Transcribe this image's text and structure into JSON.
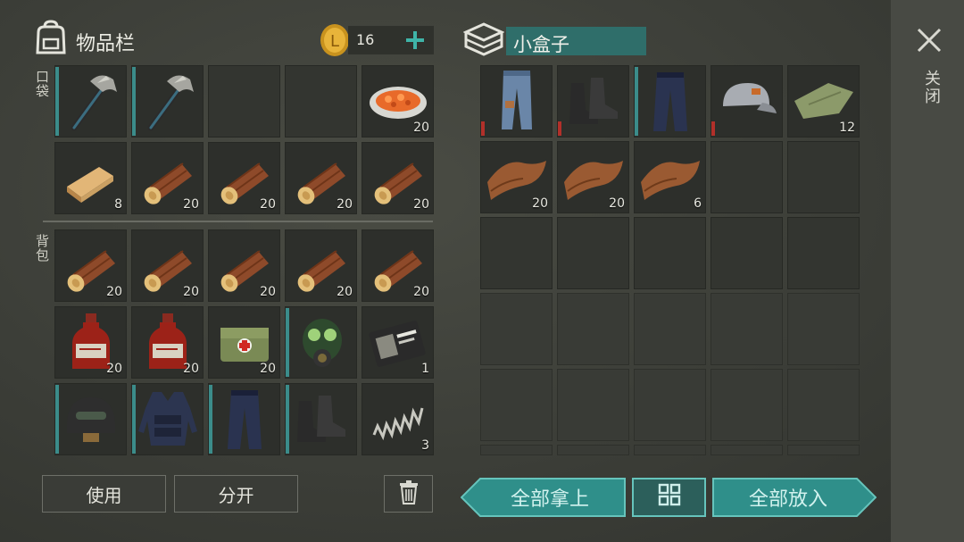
{
  "inventory": {
    "title": "物品栏",
    "coins": "16",
    "pocket_label": "口袋",
    "backpack_label": "背包"
  },
  "pocket": [
    {
      "name": "hatchet",
      "icon": "hatchet-icon",
      "qty": "",
      "dur": "teal"
    },
    {
      "name": "hatchet",
      "icon": "hatchet-icon",
      "qty": "",
      "dur": "teal"
    },
    {
      "name": "empty",
      "icon": "",
      "qty": "",
      "dur": ""
    },
    {
      "name": "empty",
      "icon": "",
      "qty": "",
      "dur": ""
    },
    {
      "name": "carrot-dish",
      "icon": "food-plate-icon",
      "qty": "20",
      "dur": ""
    },
    {
      "name": "plank",
      "icon": "plank-icon",
      "qty": "8",
      "dur": ""
    },
    {
      "name": "log",
      "icon": "log-icon",
      "qty": "20",
      "dur": ""
    },
    {
      "name": "log",
      "icon": "log-icon",
      "qty": "20",
      "dur": ""
    },
    {
      "name": "log",
      "icon": "log-icon",
      "qty": "20",
      "dur": ""
    },
    {
      "name": "log",
      "icon": "log-icon",
      "qty": "20",
      "dur": ""
    }
  ],
  "backpack": [
    {
      "name": "log",
      "icon": "log-icon",
      "qty": "20",
      "dur": ""
    },
    {
      "name": "log",
      "icon": "log-icon",
      "qty": "20",
      "dur": ""
    },
    {
      "name": "log",
      "icon": "log-icon",
      "qty": "20",
      "dur": ""
    },
    {
      "name": "log",
      "icon": "log-icon",
      "qty": "20",
      "dur": ""
    },
    {
      "name": "log",
      "icon": "log-icon",
      "qty": "20",
      "dur": ""
    },
    {
      "name": "bottle",
      "icon": "bottle-icon",
      "qty": "20",
      "dur": ""
    },
    {
      "name": "bottle",
      "icon": "bottle-icon",
      "qty": "20",
      "dur": ""
    },
    {
      "name": "medkit",
      "icon": "medkit-icon",
      "qty": "20",
      "dur": ""
    },
    {
      "name": "gas-mask",
      "icon": "gas-mask-icon",
      "qty": "",
      "dur": "teal"
    },
    {
      "name": "wallet",
      "icon": "wallet-icon",
      "qty": "1",
      "dur": ""
    },
    {
      "name": "helmet",
      "icon": "helmet-icon",
      "qty": "",
      "dur": "teal"
    },
    {
      "name": "vest",
      "icon": "vest-icon",
      "qty": "",
      "dur": "teal"
    },
    {
      "name": "tactical-pants",
      "icon": "pants-icon",
      "qty": "",
      "dur": "teal"
    },
    {
      "name": "boots",
      "icon": "boots-icon",
      "qty": "",
      "dur": "teal"
    },
    {
      "name": "spring",
      "icon": "spring-icon",
      "qty": "3",
      "dur": ""
    }
  ],
  "container": {
    "title": "小盒子",
    "close_label": "关闭",
    "items": [
      {
        "name": "jeans",
        "icon": "jeans-icon",
        "qty": "",
        "dur": "red"
      },
      {
        "name": "boots-brown",
        "icon": "boots-icon",
        "qty": "",
        "dur": "red"
      },
      {
        "name": "brown-pants",
        "icon": "pants-icon",
        "qty": "",
        "dur": "teal"
      },
      {
        "name": "cap",
        "icon": "cap-icon",
        "qty": "",
        "dur": "red"
      },
      {
        "name": "cloth",
        "icon": "cloth-icon",
        "qty": "12",
        "dur": ""
      },
      {
        "name": "leather",
        "icon": "leather-icon",
        "qty": "20",
        "dur": ""
      },
      {
        "name": "leather",
        "icon": "leather-icon",
        "qty": "20",
        "dur": ""
      },
      {
        "name": "leather",
        "icon": "leather-icon",
        "qty": "6",
        "dur": ""
      }
    ]
  },
  "buttons": {
    "use": "使用",
    "split": "分开",
    "take_all": "全部拿上",
    "put_all": "全部放入"
  }
}
